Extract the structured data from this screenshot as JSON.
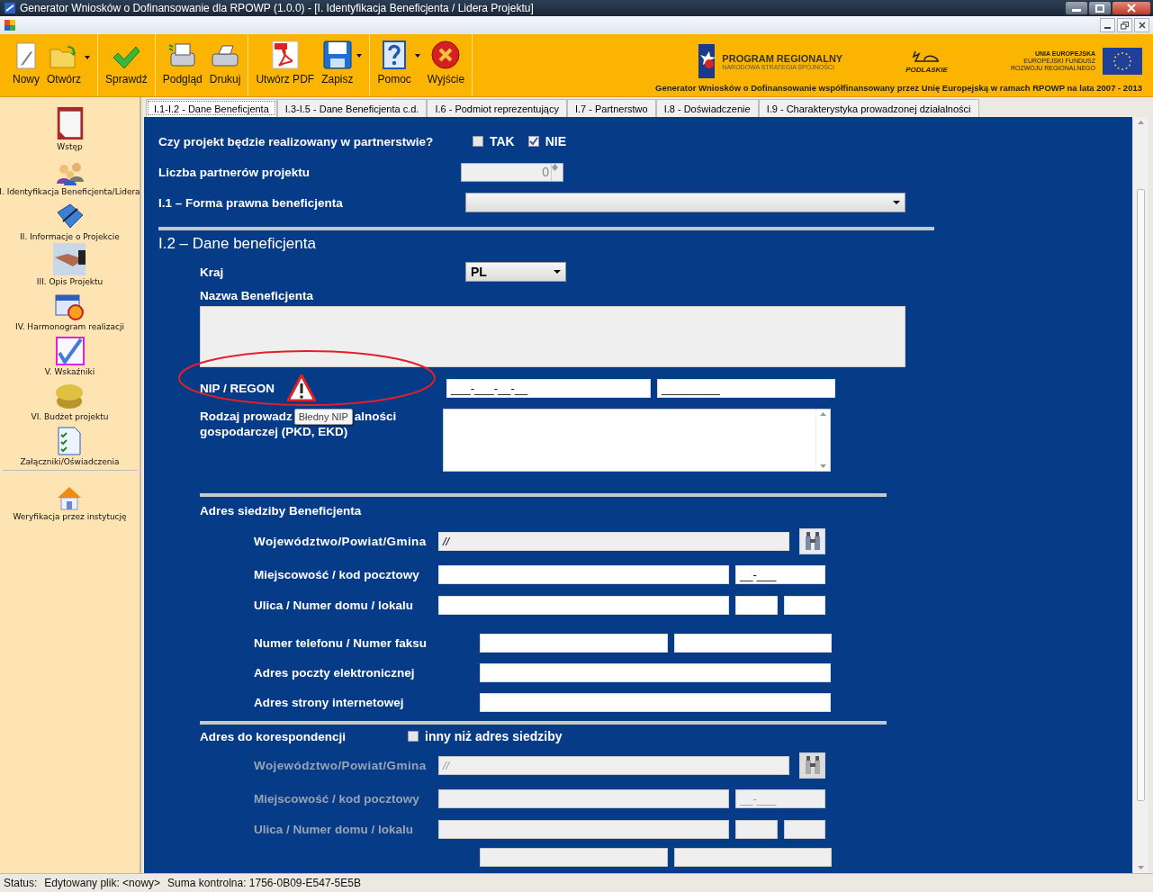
{
  "window": {
    "title": "Generator Wniosków o Dofinansowanie dla RPOWP (1.0.0) - [I. Identyfikacja Beneficjenta / Lidera Projektu]"
  },
  "toolbar": {
    "groups": [
      [
        {
          "label": "Nowy",
          "kind": "new",
          "dropdown": false
        },
        {
          "label": "Otwórz",
          "kind": "open",
          "dropdown": true
        }
      ],
      [
        {
          "label": "Sprawdź",
          "kind": "check",
          "dropdown": false
        }
      ],
      [
        {
          "label": "Podgląd",
          "kind": "preview",
          "dropdown": false
        },
        {
          "label": "Drukuj",
          "kind": "print",
          "dropdown": false
        }
      ],
      [
        {
          "label": "Utwórz PDF",
          "kind": "pdf",
          "dropdown": false
        },
        {
          "label": "Zapisz",
          "kind": "save",
          "dropdown": true
        }
      ],
      [
        {
          "label": "Pomoc",
          "kind": "help",
          "dropdown": true
        },
        {
          "label": "Wyjście",
          "kind": "exit",
          "dropdown": false
        }
      ]
    ]
  },
  "banner": {
    "program": "PROGRAM REGIONALNY",
    "program_sub": "NARODOWA STRATEGIA SPÓJNOŚCI",
    "region": "PODLASKIE",
    "eu_lines": [
      "UNIA EUROPEJSKA",
      "EUROPEJSKI FUNDUSZ",
      "ROZWOJU REGIONALNEGO"
    ],
    "tagline": "Generator Wniosków o Dofinansowanie współfinansowany przez Unię Europejską w ramach RPOWP na lata 2007 - 2013"
  },
  "sidebar": {
    "items": [
      {
        "label": "Wstęp",
        "kind": "clipboard"
      },
      {
        "label": "I. Identyfikacja Beneficjenta/Lidera",
        "kind": "people"
      },
      {
        "label": "II. Informacje o Projekcie",
        "kind": "book"
      },
      {
        "label": "III. Opis Projektu",
        "kind": "handshake"
      },
      {
        "label": "IV. Harmonogram realizacji",
        "kind": "calendar"
      },
      {
        "label": "V. Wskaźniki",
        "kind": "checkdoc"
      },
      {
        "label": "VI. Budżet projektu",
        "kind": "coins"
      },
      {
        "label": "Załączniki/Oświadczenia",
        "kind": "checklist"
      }
    ],
    "footer_items": [
      {
        "label": "Weryfikacja przez instytucję",
        "kind": "house"
      }
    ]
  },
  "tabs": [
    {
      "label": "I.1-I.2 - Dane Beneficjenta",
      "selected": true
    },
    {
      "label": "I.3-I.5 - Dane Beneficjenta c.d.",
      "selected": false
    },
    {
      "label": "I.6 - Podmiot reprezentujący",
      "selected": false
    },
    {
      "label": "I.7 - Partnerstwo",
      "selected": false
    },
    {
      "label": "I.8 - Doświadczenie",
      "selected": false
    },
    {
      "label": "I.9 - Charakterystyka prowadzonej działalności",
      "selected": false
    }
  ],
  "form": {
    "partnership": {
      "label": "Czy projekt będzie realizowany w partnerstwie?",
      "options": [
        {
          "label": "TAK",
          "checked": false
        },
        {
          "label": "NIE",
          "checked": true
        }
      ]
    },
    "partners_count": {
      "label": "Liczba partnerów projektu",
      "value": "0"
    },
    "legal_form": {
      "label": "I.1 – Forma prawna beneficjenta"
    },
    "section_title": "I.2 – Dane beneficjenta",
    "country": {
      "label": "Kraj",
      "value": "PL"
    },
    "name": {
      "label": "Nazwa Beneficjenta"
    },
    "nip": {
      "label": "NIP / REGON",
      "nip_value": "___-___-__-__",
      "regon_value": "_________",
      "error": true,
      "tooltip": "Błedny NIP"
    },
    "activity": {
      "label_start": "Rodzaj prowadz",
      "label_end": "alności",
      "label_line2": "gospodarczej (PKD, EKD)"
    },
    "seat": {
      "title": "Adres siedziby Beneficjenta",
      "disabled": false,
      "region": {
        "label": "Województwo/Powiat/Gmina",
        "value": "//"
      },
      "city": {
        "label": "Miejscowość / kod pocztowy",
        "postcode": "__-___"
      },
      "street": {
        "label": "Ulica / Numer domu / lokalu"
      }
    },
    "contact": [
      {
        "label": "Numer telefonu / Numer faksu",
        "kind": "pair"
      },
      {
        "label": "Adres poczty elektronicznej",
        "kind": "single"
      },
      {
        "label": "Adres strony internetowej",
        "kind": "single"
      }
    ],
    "correspondence": {
      "title": "Adres do korespondencji",
      "other": {
        "label": "inny niż adres siedziby",
        "checked": false
      },
      "disabled": true,
      "region": {
        "label": "Województwo/Powiat/Gmina",
        "value": "//"
      },
      "city": {
        "label": "Miejscowość / kod pocztowy",
        "postcode": "__-___"
      },
      "street": {
        "label": "Ulica / Numer domu / lokalu"
      }
    }
  },
  "status_bar": {
    "label": "Status:",
    "file": "Edytowany plik: <nowy>",
    "checksum": "Suma kontrolna: 1756-0B09-E547-5E5B"
  }
}
